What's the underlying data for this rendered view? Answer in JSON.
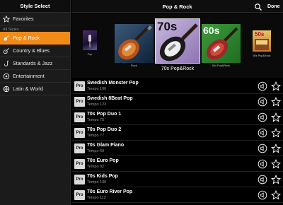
{
  "sidebar": {
    "title": "Style Select",
    "favorites_label": "Favorites",
    "section_label": "All Styles",
    "items": [
      {
        "label": "Pop & Rock",
        "icon": "guitar-icon",
        "selected": true
      },
      {
        "label": "Country & Blues",
        "icon": "acoustic-guitar-icon",
        "selected": false
      },
      {
        "label": "Standards & Jazz",
        "icon": "saxophone-icon",
        "selected": false
      },
      {
        "label": "Entertainment",
        "icon": "microphone-icon",
        "selected": false
      },
      {
        "label": "Latin & World",
        "icon": "globe-icon",
        "selected": false
      }
    ]
  },
  "header": {
    "title": "Pop & Rock",
    "done_label": "Done"
  },
  "carousel": {
    "selected_caption": "70s Pop&Rock",
    "items": [
      {
        "badge": "",
        "caption": "Pop"
      },
      {
        "badge": "",
        "caption": "Rock"
      },
      {
        "badge": "70s",
        "caption": "70s Pop&Rock"
      },
      {
        "badge": "60s",
        "caption": "60s Pop&Rock"
      },
      {
        "badge": "50s",
        "caption": "50s Pop&Rock"
      }
    ]
  },
  "list": {
    "badge_label": "Pro",
    "rows": [
      {
        "name": "Swedish Monster Pop",
        "tempo": "Tempo 100"
      },
      {
        "name": "Swedish 8Beat Pop",
        "tempo": "Tempo 123"
      },
      {
        "name": "70s Pop Duo 1",
        "tempo": "Tempo 75"
      },
      {
        "name": "70s Pop Duo 2",
        "tempo": "Tempo 77"
      },
      {
        "name": "70s Glam Piano",
        "tempo": "Tempo 69"
      },
      {
        "name": "70s Euro Pop",
        "tempo": "Tempo 92"
      },
      {
        "name": "70s Kids Pop",
        "tempo": "Tempo 130"
      },
      {
        "name": "70s Euro River Pop",
        "tempo": "Tempo 112"
      }
    ]
  },
  "colors": {
    "accent": "#f28a18",
    "background": "#000000",
    "sidebar": "#1b1b1b"
  }
}
